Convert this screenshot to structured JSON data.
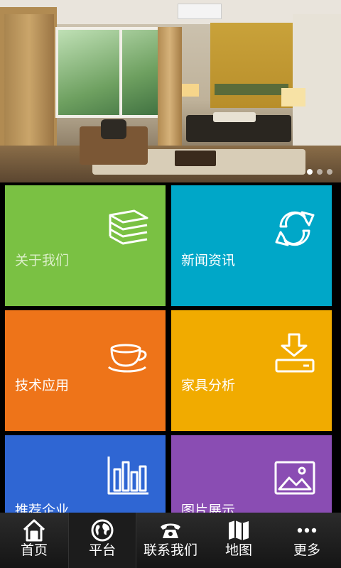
{
  "banner": {
    "slide_count": 3,
    "active_slide": 1
  },
  "tiles": [
    {
      "label": "关于我们",
      "color": "#7ac143",
      "icon": "stacked-papers-icon"
    },
    {
      "label": "新闻资讯",
      "color": "#00a7c8",
      "icon": "refresh-arrows-icon"
    },
    {
      "label": "技术应用",
      "color": "#ee7419",
      "icon": "coffee-cup-icon"
    },
    {
      "label": "家具分析",
      "color": "#f1ab00",
      "icon": "download-tray-icon"
    },
    {
      "label": "推荐企业",
      "color": "#2f66d3",
      "icon": "bar-chart-icon"
    },
    {
      "label": "图片展示",
      "color": "#8a4db3",
      "icon": "picture-icon"
    }
  ],
  "tabbar": {
    "items": [
      {
        "label": "首页",
        "icon": "home-icon",
        "active": false
      },
      {
        "label": "平台",
        "icon": "globe-icon",
        "active": true
      },
      {
        "label": "联系我们",
        "icon": "telephone-icon",
        "active": false
      },
      {
        "label": "地图",
        "icon": "map-icon",
        "active": false
      },
      {
        "label": "更多",
        "icon": "more-dots-icon",
        "active": false
      }
    ]
  }
}
